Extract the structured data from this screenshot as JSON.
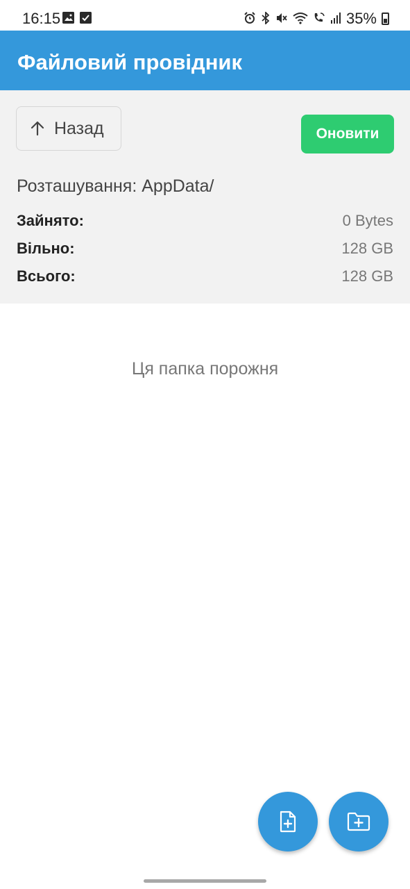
{
  "status_bar": {
    "time": "16:15",
    "battery_percent": "35%",
    "battery_level": 0.35,
    "left_icons": [
      "gallery-icon",
      "checkbox-icon"
    ],
    "right_icons": [
      "alarm-icon",
      "bluetooth-icon",
      "mute-icon",
      "wifi-icon",
      "wifi-calling-icon",
      "signal-icon",
      "battery-icon"
    ]
  },
  "app_bar": {
    "title": "Файловий провідник"
  },
  "toolbar": {
    "back_label": "Назад",
    "refresh_label": "Оновити"
  },
  "location": "Розташування: AppData/",
  "storage": {
    "used_label": "Зайнято:",
    "used_value": "0 Bytes",
    "free_label": "Вільно:",
    "free_value": "128 GB",
    "total_label": "Всього:",
    "total_value": "128 GB"
  },
  "empty_message": "Ця папка порожня",
  "fabs": {
    "new_file_icon": "file-plus-icon",
    "new_folder_icon": "folder-plus-icon"
  },
  "colors": {
    "primary": "#3498db",
    "refresh": "#2ecc71",
    "panel_bg": "#f2f2f2"
  }
}
